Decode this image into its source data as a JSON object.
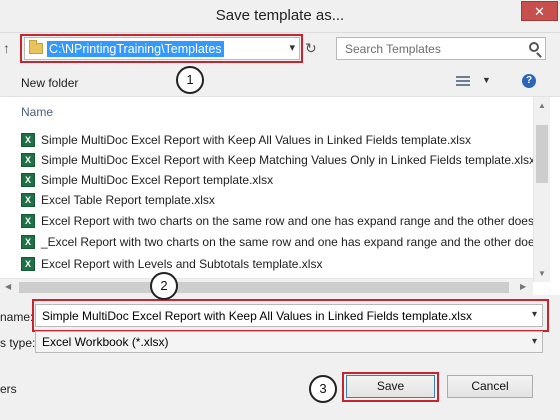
{
  "window": {
    "title": "Save template as...",
    "close_label": "✕"
  },
  "address_bar": {
    "path": "C:\\NPrintingTraining\\Templates"
  },
  "search": {
    "placeholder": "Search Templates"
  },
  "toolbar": {
    "new_folder_label": "New folder",
    "help_label": "?"
  },
  "file_list": {
    "column_name": "Name",
    "items": [
      {
        "label": "Simple MultiDoc Excel Report with Keep All Values in Linked Fields template.xlsx"
      },
      {
        "label": "Simple MultiDoc Excel Report with Keep Matching Values Only in Linked Fields template.xlsx"
      },
      {
        "label": "Simple MultiDoc Excel Report template.xlsx"
      },
      {
        "label": "Excel Table Report template.xlsx"
      },
      {
        "label": "Excel Report with two charts on the same row and one has expand range and the other does n"
      },
      {
        "label": "_Excel Report with two charts on the same row and one has expand range and the other does ."
      },
      {
        "label": "Excel Report with Levels and Subtotals template.xlsx"
      }
    ],
    "icon_glyph": "X"
  },
  "form": {
    "file_name_label": "name:",
    "file_name_value": "Simple MultiDoc Excel Report with Keep All Values in Linked Fields template.xlsx",
    "save_type_label": "s type:",
    "save_type_value": "Excel Workbook (*.xlsx)",
    "folders_label": "ers"
  },
  "buttons": {
    "save_label": "Save",
    "cancel_label": "Cancel"
  },
  "callouts": [
    "1",
    "2",
    "3"
  ],
  "colors": {
    "highlight_outline": "#c4252e",
    "selection": "#3399ff",
    "excel_icon": "#1e7145",
    "close_button": "#c7504c"
  }
}
